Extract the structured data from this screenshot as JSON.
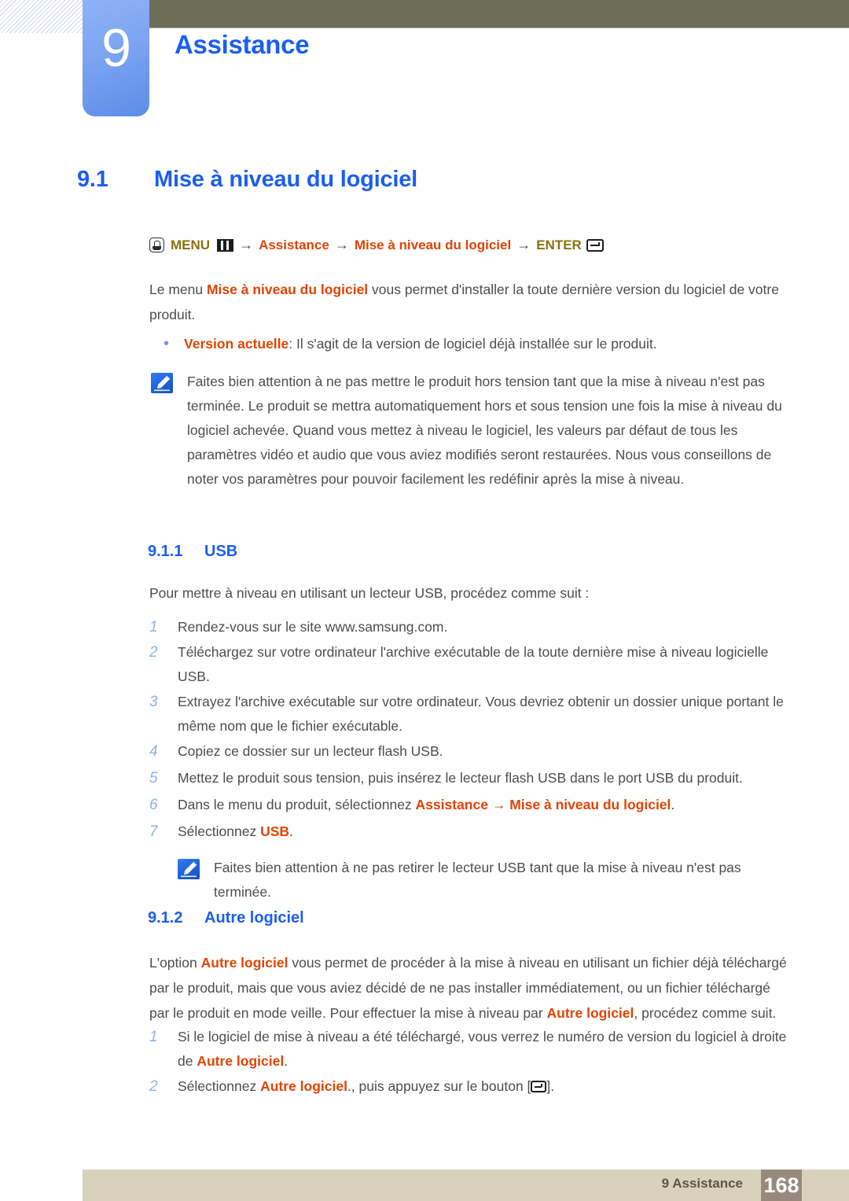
{
  "chapter": {
    "number": "9",
    "title": "Assistance"
  },
  "section": {
    "number": "9.1",
    "title": "Mise à niveau du logiciel"
  },
  "breadcrumb": {
    "menu_label": "MENU",
    "arrow": "→",
    "item1": "Assistance",
    "item2": "Mise à niveau du logiciel",
    "enter_label": "ENTER",
    "hand_icon": "hand-press-icon",
    "grid_icon": "menu-grid-icon",
    "enter_icon": "enter-key-icon"
  },
  "intro": {
    "before": "Le menu ",
    "keyword": "Mise à niveau du logiciel",
    "after": " vous permet d'installer la toute dernière version du logiciel de votre produit."
  },
  "bullet": {
    "marker": "•",
    "keyword": "Version actuelle",
    "text": ": Il s'agit de la version de logiciel déjà installée sur le produit."
  },
  "note1": {
    "icon": "note-pen-icon",
    "text": "Faites bien attention à ne pas mettre le produit hors tension tant que la mise à niveau n'est pas terminée. Le produit se mettra automatiquement hors et sous tension une fois la mise à niveau du logiciel achevée. Quand vous mettez à niveau le logiciel, les valeurs par défaut de tous les paramètres vidéo et audio que vous aviez modifiés seront restaurées. Nous vous conseillons de noter vos paramètres pour pouvoir facilement les redéfinir après la mise à niveau."
  },
  "subsection_usb": {
    "number": "9.1.1",
    "title": "USB",
    "intro": "Pour mettre à niveau en utilisant un lecteur USB, procédez comme suit :",
    "steps": [
      {
        "num": "1",
        "text": "Rendez-vous sur le site www.samsung.com."
      },
      {
        "num": "2",
        "text": "Téléchargez sur votre ordinateur l'archive exécutable de la toute dernière mise à niveau logicielle USB."
      },
      {
        "num": "3",
        "text": "Extrayez l'archive exécutable sur votre ordinateur. Vous devriez obtenir un dossier unique portant le même nom que le fichier exécutable."
      },
      {
        "num": "4",
        "text": "Copiez ce dossier sur un lecteur flash USB."
      },
      {
        "num": "5",
        "text": "Mettez le produit sous tension, puis insérez le lecteur flash USB dans le port USB du produit."
      },
      {
        "num": "6",
        "text": "Dans le menu du produit, sélectionnez ",
        "kw1": "Assistance",
        "mid": " → ",
        "kw2": "Mise à niveau du logiciel",
        "tail": "."
      },
      {
        "num": "7",
        "text": "Sélectionnez ",
        "kw1": "USB",
        "tail": "."
      }
    ]
  },
  "note2": {
    "icon": "note-pen-icon",
    "text": "Faites bien attention à ne pas retirer le lecteur USB tant que la mise à niveau n'est pas terminée."
  },
  "subsection_autre": {
    "number": "9.1.2",
    "title": "Autre logiciel",
    "para": {
      "p1": "L'option ",
      "kw1": "Autre logiciel",
      "p2": " vous permet de procéder à la mise à niveau en utilisant un fichier déjà téléchargé par le produit, mais que vous aviez décidé de ne pas installer immédiatement, ou un fichier téléchargé par le produit en mode veille. Pour effectuer la mise à niveau par ",
      "kw2": "Autre logiciel",
      "p3": ", procédez comme suit."
    },
    "steps": [
      {
        "num": "1",
        "text": "Si le logiciel de mise à niveau a été téléchargé, vous verrez le numéro de version du logiciel à droite de ",
        "kw1": "Autre logiciel",
        "tail": "."
      },
      {
        "num": "2",
        "text": "Sélectionnez ",
        "kw1": "Autre logiciel",
        "mid": "., puis appuyez sur le bouton [",
        "tail": "]."
      }
    ]
  },
  "footer": {
    "label": "9 Assistance",
    "page": "168"
  },
  "colors": {
    "accent_blue": "#1b5ef0",
    "keyword_orange": "#e04403",
    "olive": "#8a7211",
    "body_gray": "#4d4d4d",
    "header_brown": "#6e6d58",
    "footer_beige": "#d8d2bd",
    "footer_page_bg": "#978a7c",
    "step_num_blue": "#8eb1ec"
  }
}
